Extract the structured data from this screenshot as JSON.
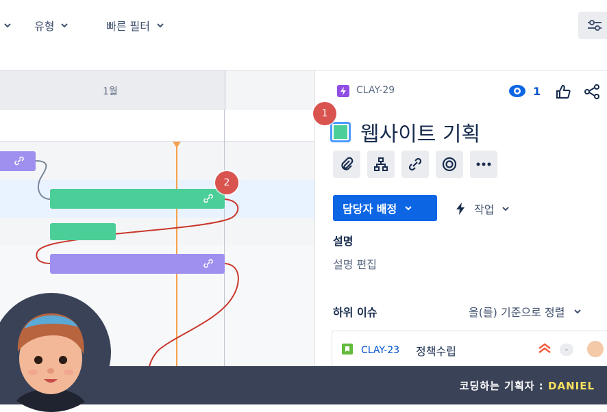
{
  "toolbar": {
    "filters": [
      {
        "label": ""
      },
      {
        "label": "유형"
      },
      {
        "label": "빠른 필터"
      }
    ]
  },
  "timeline": {
    "month_label": "1월"
  },
  "panel": {
    "issue_key": "CLAY-29",
    "watch_count": "1",
    "title": "웹사이트 기획",
    "assign_button": "담당자 배정",
    "action_label": "작업",
    "description_heading": "설명",
    "description_placeholder": "설명 편집",
    "child_heading": "하위 이슈",
    "sort_label": "을(를) 기준으로 정렬",
    "child_issue": {
      "key": "CLAY-23",
      "summary": "정책수립",
      "estimate": "-"
    }
  },
  "markers": {
    "one": "1",
    "two": "2"
  },
  "footer": {
    "credit_prefix": "코딩하는 기획자 : ",
    "credit_name": "DANIEL"
  },
  "colors": {
    "accent": "#0c66e4",
    "epic_green": "#4bce97",
    "bar_purple": "#9f8fef",
    "today_line": "#f5a14d",
    "dependency": "#c9372c",
    "marker": "#d9534f"
  }
}
